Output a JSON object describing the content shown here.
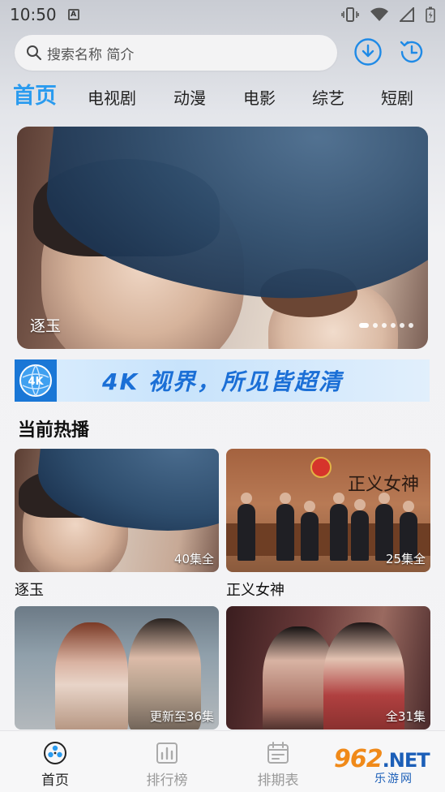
{
  "status_bar": {
    "time": "10:50",
    "notification_icon": "A"
  },
  "search": {
    "placeholder": "搜索名称 简介"
  },
  "tabs": [
    {
      "label": "首页",
      "active": true
    },
    {
      "label": "电视剧"
    },
    {
      "label": "动漫"
    },
    {
      "label": "电影"
    },
    {
      "label": "综艺"
    },
    {
      "label": "短剧"
    }
  ],
  "banner": {
    "title": "逐玉",
    "slides": 6,
    "active_slide": 1
  },
  "promo": {
    "logo_text": "4K",
    "text": "4K 视界，所见皆超清"
  },
  "section": {
    "title": "当前热播"
  },
  "cards": [
    {
      "title": "逐玉",
      "badge": "40集全"
    },
    {
      "title": "正义女神",
      "badge": "25集全",
      "poster_text": "正义女神"
    },
    {
      "badge": "更新至36集"
    },
    {
      "badge": "全31集"
    }
  ],
  "bottom_nav": [
    {
      "label": "首页",
      "active": true,
      "icon": "home-film-reel-icon"
    },
    {
      "label": "排行榜",
      "icon": "ranking-chart-icon"
    },
    {
      "label": "排期表",
      "icon": "calendar-icon"
    }
  ],
  "watermark": {
    "logo": "962",
    "net": ".NET",
    "sub": "乐游网"
  },
  "colors": {
    "accent": "#2a9bef",
    "promo_blue": "#1b6fd6"
  }
}
